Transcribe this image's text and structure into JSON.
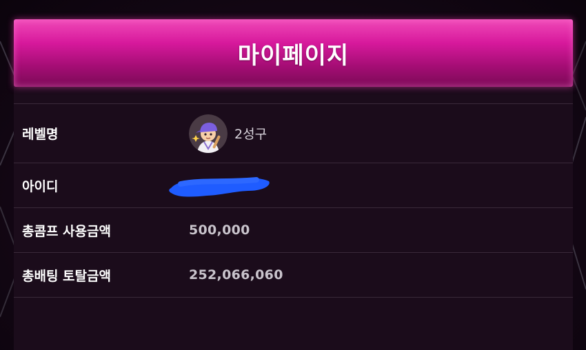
{
  "page": {
    "title": "마이페이지"
  },
  "info_rows": [
    {
      "label": "레벨명",
      "value": "2성구"
    },
    {
      "label": "아이디",
      "value": ""
    },
    {
      "label": "총콤프 사용금액",
      "value": "500,000"
    },
    {
      "label": "총배팅 토탈금액",
      "value": "252,066,060"
    }
  ],
  "avatar_icon": "baseball-player-avatar-icon",
  "redaction_color": "#1f5cff",
  "colors": {
    "header_pink": "#d7199c",
    "background": "#150716"
  }
}
